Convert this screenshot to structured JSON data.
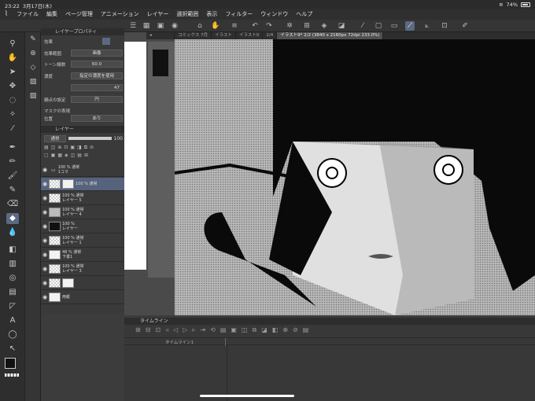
{
  "status": {
    "time": "23:22",
    "date": "3月17日(木)",
    "battery": "74%",
    "battery_level": 0.74
  },
  "menu": [
    "ファイル",
    "編集",
    "ページ管理",
    "アニメーション",
    "レイヤー",
    "選択範囲",
    "表示",
    "フィルター",
    "ウィンドウ",
    "ヘルプ"
  ],
  "props": {
    "title": "レイヤープロパティ",
    "effect_label": "効果",
    "effect_area_label": "効果範囲",
    "effect_area_value": "画像",
    "tone_lines_label": "トーン線数",
    "tone_lines_value": "60.0",
    "density_label": "濃度",
    "density_value": "指定の濃度を使用",
    "angle_value": "47",
    "grid_label": "網点の設定",
    "grid_value": "円",
    "mask_label": "マスクの表現",
    "position_label": "位置",
    "position_value": "あり"
  },
  "layers": {
    "title": "レイヤー",
    "blend": "通常",
    "opacity": "100",
    "rows": [
      {
        "l1": "100 % 通常",
        "l2": "1コマ"
      },
      {
        "l1": "100 % 通常",
        "l2": ""
      },
      {
        "l1": "100 % 通常",
        "l2": "レイヤー 5"
      },
      {
        "l1": "100 % 通常",
        "l2": "レイヤー 4"
      },
      {
        "l1": "100 %",
        "l2": "レイヤー"
      },
      {
        "l1": "100 % 通常",
        "l2": "レイヤー 1"
      },
      {
        "l1": "48 % 通常",
        "l2": "下書1"
      },
      {
        "l1": "100 % 通常",
        "l2": "レイヤー 3"
      },
      {
        "l1": "",
        "l2": ""
      },
      {
        "l1": "",
        "l2": "用紙"
      }
    ]
  },
  "tabs": [
    "コミックス 7月",
    "イラスト",
    "イラスト0",
    "2/4",
    "イラスト9* 2/2 (3840 x 2160px 72dpi 233.0%)"
  ],
  "timeline": {
    "title": "タイムライン",
    "track": "タイムライン1"
  }
}
